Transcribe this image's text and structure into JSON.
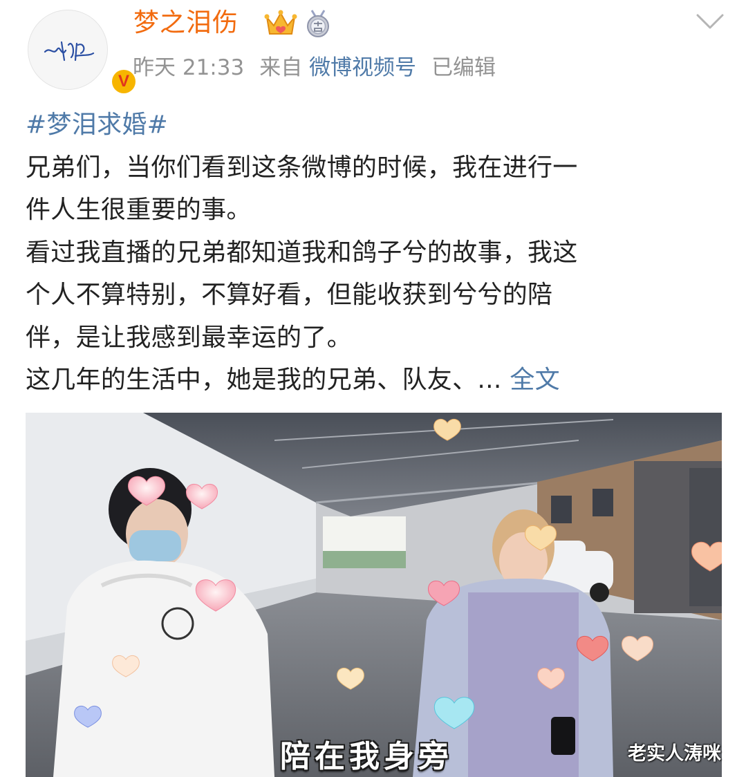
{
  "post": {
    "author": {
      "name": "梦之泪伤",
      "avatar_signature": "梦泪",
      "verified_badge": "V",
      "icons": [
        "crown-badge-icon",
        "medal-badge-icon",
        "verified-v-icon"
      ]
    },
    "meta": {
      "time": "昨天 21:33",
      "from_label": "来自",
      "source": "微博视频号",
      "edited": "已编辑"
    },
    "hashtag": "#梦泪求婚#",
    "body_lines": [
      "兄弟们，当你们看到这条微博的时候，我在进行一",
      "件人生很重要的事。",
      "看过我直播的兄弟都知道我和鸽子兮的故事，我这",
      "个人不算特别，不算好看，但能收获到兮兮的陪",
      "伴，是让我感到最幸运的了。",
      "这几年的生活中，她是我的兄弟、队友、... "
    ],
    "more_link": "全文"
  },
  "video": {
    "subtitle": "陪在我身旁",
    "watermark": "老实人涛咪"
  },
  "colors": {
    "username": "#f26b0f",
    "link": "#4f7aa8",
    "meta": "#939393",
    "text": "#222222"
  }
}
